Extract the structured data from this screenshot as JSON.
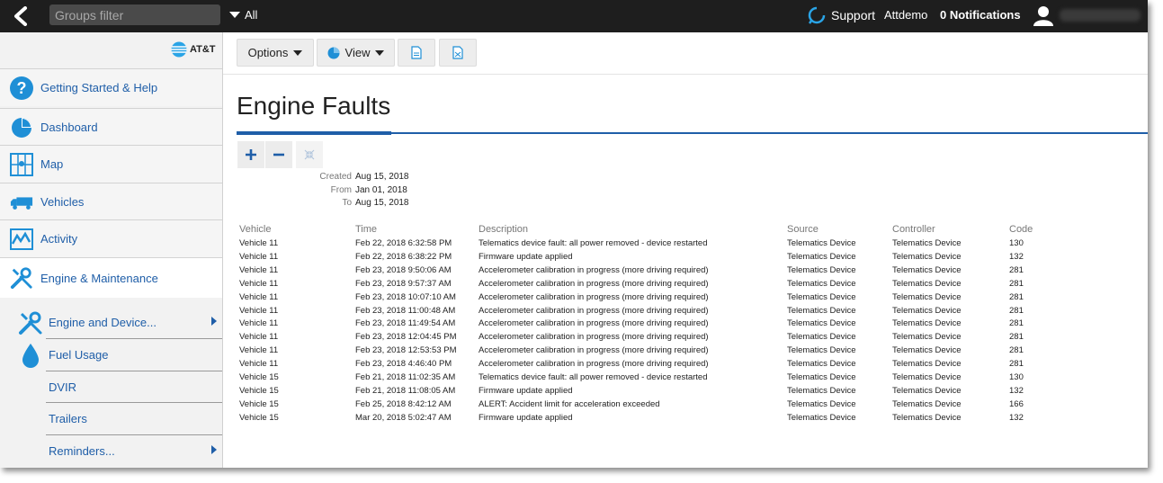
{
  "topbar": {
    "groups_filter_placeholder": "Groups filter",
    "all_label": "All",
    "support_label": "Support",
    "user_company": "Attdemo",
    "notifications_label": "0 Notifications"
  },
  "sidebar": {
    "brand": "AT&T",
    "items": [
      {
        "label": "Getting Started & Help"
      },
      {
        "label": "Dashboard"
      },
      {
        "label": "Map"
      },
      {
        "label": "Vehicles"
      },
      {
        "label": "Activity"
      },
      {
        "label": "Engine & Maintenance"
      }
    ],
    "subitems": [
      {
        "label": "Engine and Device..."
      },
      {
        "label": "Fuel Usage"
      },
      {
        "label": "DVIR"
      },
      {
        "label": "Trailers"
      },
      {
        "label": "Reminders..."
      }
    ]
  },
  "toolbar": {
    "options_label": "Options",
    "view_label": "View"
  },
  "page": {
    "title": "Engine Faults",
    "meta": {
      "created_label": "Created",
      "created_value": "Aug 15, 2018",
      "from_label": "From",
      "from_value": "Jan 01, 2018",
      "to_label": "To",
      "to_value": "Aug 15, 2018"
    }
  },
  "table": {
    "columns": [
      "Vehicle",
      "Time",
      "Description",
      "Source",
      "Controller",
      "Code"
    ],
    "rows": [
      [
        "Vehicle 11",
        "Feb 22, 2018 6:32:58 PM",
        "Telematics device fault: all power removed - device restarted",
        "Telematics Device",
        "Telematics Device",
        "130"
      ],
      [
        "Vehicle 11",
        "Feb 22, 2018 6:38:22 PM",
        "Firmware update applied",
        "Telematics Device",
        "Telematics Device",
        "132"
      ],
      [
        "Vehicle 11",
        "Feb 23, 2018 9:50:06 AM",
        "Accelerometer calibration in progress (more driving required)",
        "Telematics Device",
        "Telematics Device",
        "281"
      ],
      [
        "Vehicle 11",
        "Feb 23, 2018 9:57:37 AM",
        "Accelerometer calibration in progress (more driving required)",
        "Telematics Device",
        "Telematics Device",
        "281"
      ],
      [
        "Vehicle 11",
        "Feb 23, 2018 10:07:10 AM",
        "Accelerometer calibration in progress (more driving required)",
        "Telematics Device",
        "Telematics Device",
        "281"
      ],
      [
        "Vehicle 11",
        "Feb 23, 2018 11:00:48 AM",
        "Accelerometer calibration in progress (more driving required)",
        "Telematics Device",
        "Telematics Device",
        "281"
      ],
      [
        "Vehicle 11",
        "Feb 23, 2018 11:49:54 AM",
        "Accelerometer calibration in progress (more driving required)",
        "Telematics Device",
        "Telematics Device",
        "281"
      ],
      [
        "Vehicle 11",
        "Feb 23, 2018 12:04:45 PM",
        "Accelerometer calibration in progress (more driving required)",
        "Telematics Device",
        "Telematics Device",
        "281"
      ],
      [
        "Vehicle 11",
        "Feb 23, 2018 12:53:53 PM",
        "Accelerometer calibration in progress (more driving required)",
        "Telematics Device",
        "Telematics Device",
        "281"
      ],
      [
        "Vehicle 11",
        "Feb 23, 2018 4:46:40 PM",
        "Accelerometer calibration in progress (more driving required)",
        "Telematics Device",
        "Telematics Device",
        "281"
      ],
      [
        "Vehicle 15",
        "Feb 21, 2018 11:02:35 AM",
        "Telematics device fault: all power removed - device restarted",
        "Telematics Device",
        "Telematics Device",
        "130"
      ],
      [
        "Vehicle 15",
        "Feb 21, 2018 11:08:05 AM",
        "Firmware update applied",
        "Telematics Device",
        "Telematics Device",
        "132"
      ],
      [
        "Vehicle 15",
        "Feb 25, 2018 8:42:12 AM",
        "ALERT: Accident limit for acceleration exceeded",
        "Telematics Device",
        "Telematics Device",
        "166"
      ],
      [
        "Vehicle 15",
        "Mar 20, 2018 5:02:47 AM",
        "Firmware update applied",
        "Telematics Device",
        "Telematics Device",
        "132"
      ]
    ]
  },
  "colors": {
    "accent": "#1f5ea8",
    "topbar_bg": "#1e1e1e",
    "sidebar_bg": "#f2f2f2"
  }
}
